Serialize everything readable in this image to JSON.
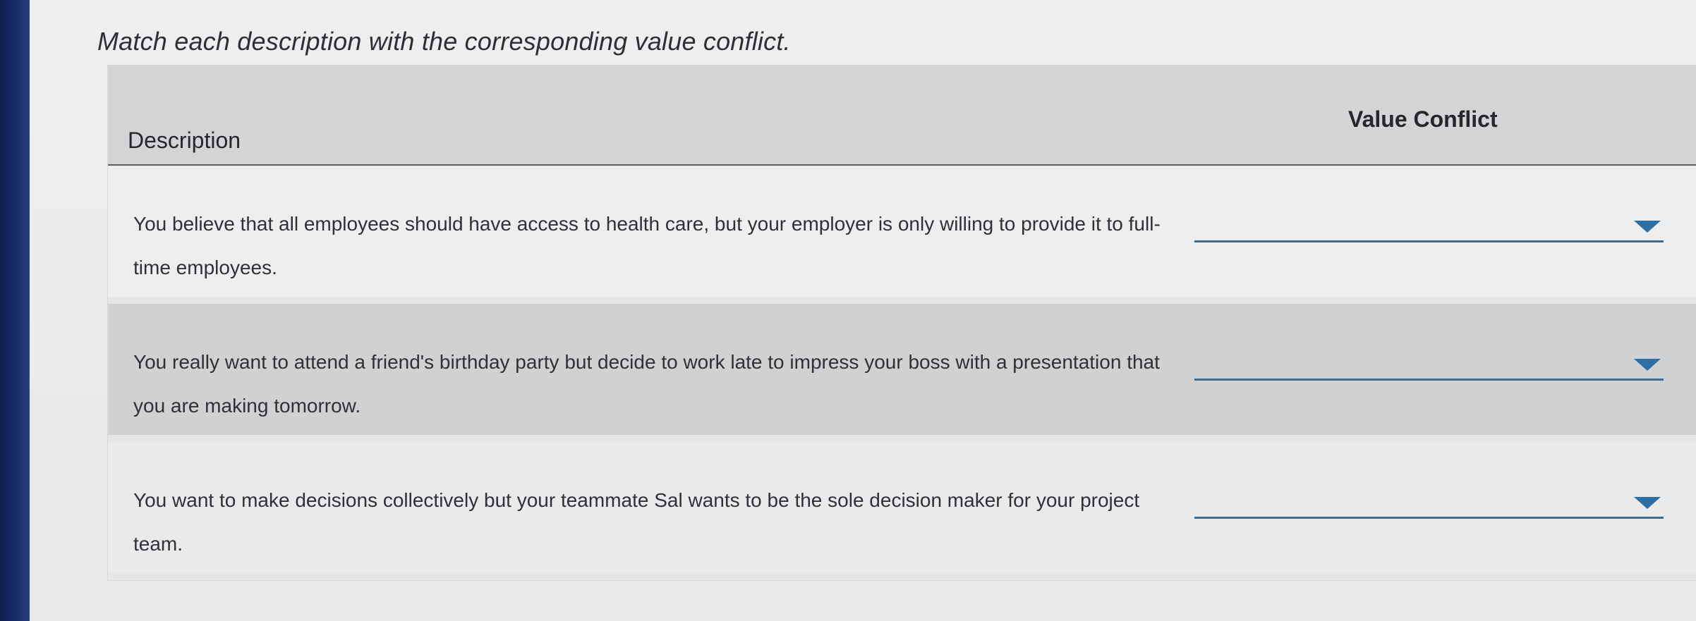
{
  "instruction": "Match each description with the corresponding value conflict.",
  "table": {
    "headers": {
      "description": "Description",
      "value_conflict": "Value Conflict"
    },
    "rows": [
      {
        "description": "You believe that all employees should have access to health care, but your employer is only willing to provide it to full-time employees.",
        "selected": ""
      },
      {
        "description": "You really want to attend a friend's birthday party but decide to work late to impress your boss with a presentation that you are making tomorrow.",
        "selected": ""
      },
      {
        "description": "You want to make decisions collectively but your teammate Sal wants to be the sole decision maker for your project team.",
        "selected": ""
      }
    ]
  },
  "icons": {
    "dropdown": "chevron-down-icon"
  },
  "colors": {
    "select_underline": "#3a6d95",
    "caret": "#2d6ea5"
  }
}
